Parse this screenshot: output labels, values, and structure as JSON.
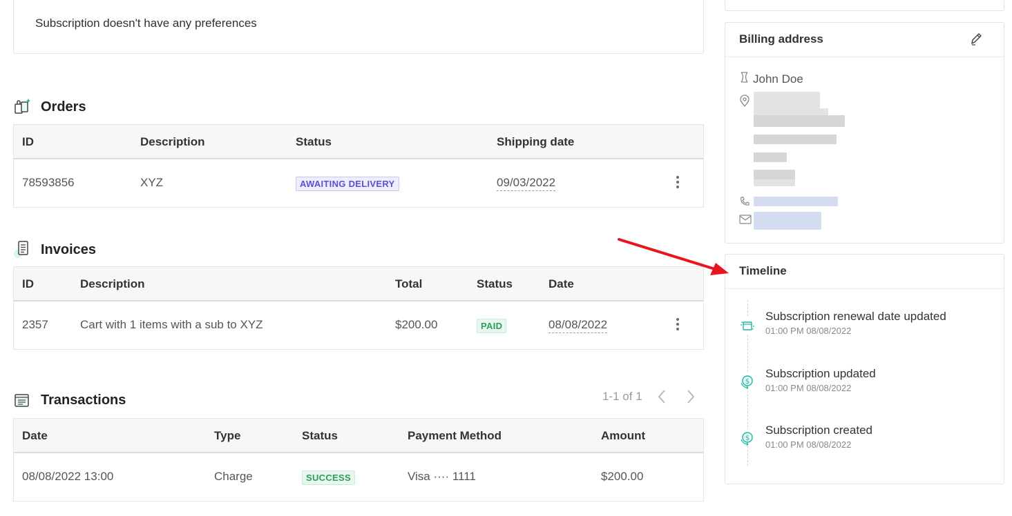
{
  "preferences": {
    "message": "Subscription doesn't have any preferences"
  },
  "orders": {
    "title": "Orders",
    "columns": [
      "ID",
      "Description",
      "Status",
      "Shipping date"
    ],
    "rows": [
      {
        "id": "78593856",
        "description": "XYZ",
        "status": "AWAITING DELIVERY",
        "shipping_date": "09/03/2022"
      }
    ]
  },
  "invoices": {
    "title": "Invoices",
    "columns": [
      "ID",
      "Description",
      "Total",
      "Status",
      "Date"
    ],
    "rows": [
      {
        "id": "2357",
        "description": "Cart with 1 items with a sub to XYZ",
        "total": "$200.00",
        "status": "PAID",
        "date": "08/08/2022"
      }
    ]
  },
  "transactions": {
    "title": "Transactions",
    "pagination": "1-1 of 1",
    "columns": [
      "Date",
      "Type",
      "Status",
      "Payment Method",
      "Amount"
    ],
    "rows": [
      {
        "date": "08/08/2022 13:00",
        "type": "Charge",
        "status": "SUCCESS",
        "payment_method": "Visa ···· 1111",
        "amount": "$200.00"
      }
    ]
  },
  "billing": {
    "title": "Billing address",
    "name": "John Doe",
    "icons": [
      "person-icon",
      "location-pin-icon",
      "phone-icon",
      "mail-icon",
      "pencil-icon"
    ]
  },
  "timeline": {
    "title": "Timeline",
    "events": [
      {
        "title": "Subscription renewal date updated",
        "time": "01:00 PM 08/08/2022",
        "icon": "calendar-refresh-icon"
      },
      {
        "title": "Subscription updated",
        "time": "01:00 PM 08/08/2022",
        "icon": "dollar-cycle-icon"
      },
      {
        "title": "Subscription created",
        "time": "01:00 PM 08/08/2022",
        "icon": "dollar-cycle-icon"
      }
    ]
  },
  "colors": {
    "accent_purple": "#5b4fd6",
    "success_green": "#2e9b5f",
    "icon_teal": "#1fb3a6",
    "annotation_red": "#e8161c"
  }
}
